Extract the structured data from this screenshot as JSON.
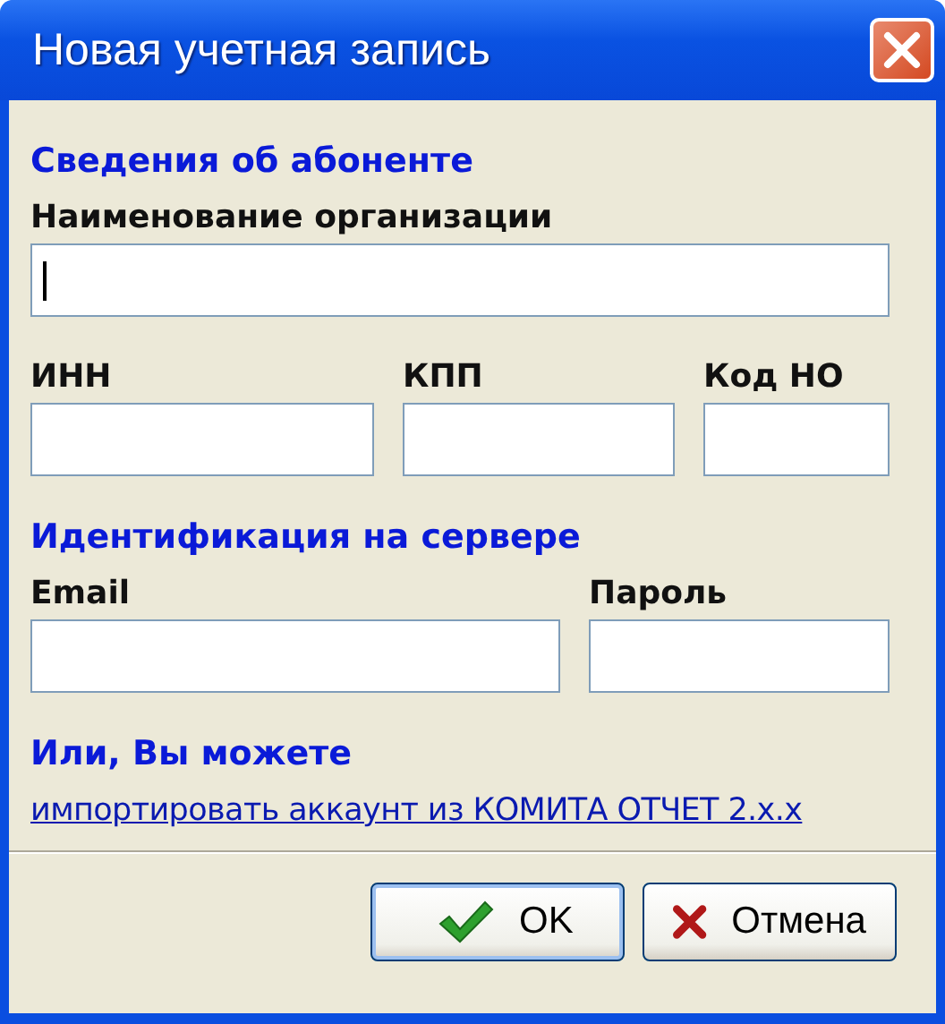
{
  "window": {
    "title": "Новая учетная запись"
  },
  "sections": [
    {
      "heading": "Сведения об абоненте",
      "rows": [
        [
          {
            "label": "Наименование организации",
            "focused": true
          }
        ],
        [
          {
            "label": "ИНН",
            "focused": false
          },
          {
            "label": "КПП",
            "focused": false
          },
          {
            "label": "Код НО",
            "focused": false
          }
        ]
      ]
    },
    {
      "heading": "Идентификация на сервере",
      "rows": [
        [
          {
            "label": "Email",
            "focused": false
          },
          {
            "label": "Пароль",
            "focused": false
          }
        ]
      ]
    }
  ],
  "import": {
    "heading": "Или, Вы можете",
    "link": "импортировать аккаунт из КОМИТА ОТЧЕТ 2.х.х"
  },
  "buttons": [
    {
      "kind": "ok",
      "label": "OK",
      "default": true
    },
    {
      "kind": "cancel",
      "label": "Отмена",
      "default": false
    }
  ]
}
